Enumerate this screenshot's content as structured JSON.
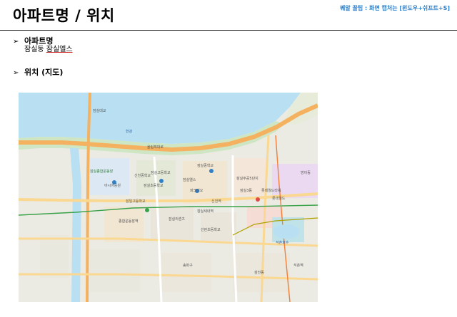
{
  "header": {
    "title": "아파트명 / 위치",
    "tip": "꿰알 꿀팁 : 화면 캡처는 [윈도우+쉬프트+S]"
  },
  "sections": [
    {
      "bullet": "➢",
      "title": "아파트명",
      "value_prefix": "잠실동 ",
      "value_link": "잠실엘스"
    },
    {
      "bullet": "➢",
      "title": "위치 (지도)"
    }
  ],
  "map": {
    "labels": [
      "잠실엘스",
      "잠실리센츠",
      "잠실주공5단지",
      "잠실3동",
      "석촌호수",
      "잠실종합운동장",
      "신천중학교",
      "잠실고등학교",
      "잠실중학교",
      "잠실초등학교",
      "잠실새내역",
      "롯데월드타워",
      "롯데월드",
      "방이동",
      "신천역",
      "종합운동장역",
      "선린초등학교",
      "잠일고등학교",
      "삼전동",
      "석촌역",
      "송파구",
      "한강",
      "잠실대교",
      "올림픽대로",
      "아시아공원",
      "파크리오"
    ]
  }
}
